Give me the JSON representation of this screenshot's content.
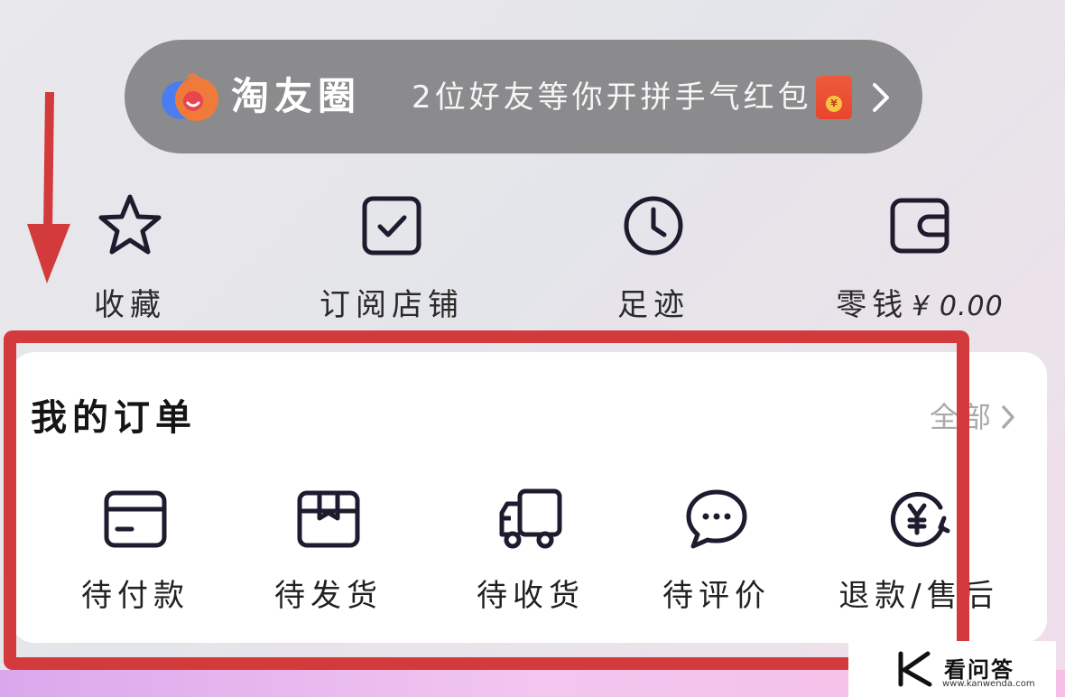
{
  "banner": {
    "title": "淘友圈",
    "text": "2位好友等你开拼手气红包",
    "coin_glyph": "¥",
    "colors": {
      "background": "#8b8b8d",
      "red_packet": "#e8452c",
      "logo_orange": "#f07a3a",
      "logo_blue": "#4a7ef0"
    }
  },
  "shortcuts": [
    {
      "icon": "star-icon",
      "label": "收藏"
    },
    {
      "icon": "checkbox-icon",
      "label": "订阅店铺"
    },
    {
      "icon": "clock-icon",
      "label": "足迹"
    },
    {
      "icon": "wallet-icon",
      "label": "零钱",
      "amount": "¥ 0.00"
    }
  ],
  "orders": {
    "title": "我的订单",
    "all_label": "全部",
    "items": [
      {
        "icon": "card-icon",
        "label": "待付款"
      },
      {
        "icon": "box-icon",
        "label": "待发货"
      },
      {
        "icon": "truck-icon",
        "label": "待收货"
      },
      {
        "icon": "chat-bubble-icon",
        "label": "待评价"
      },
      {
        "icon": "refund-icon",
        "label": "退款/售后"
      }
    ]
  },
  "annotation": {
    "color": "#d23a3c"
  },
  "watermark": {
    "name": "看问答",
    "url": "www.kanwenda.com"
  }
}
